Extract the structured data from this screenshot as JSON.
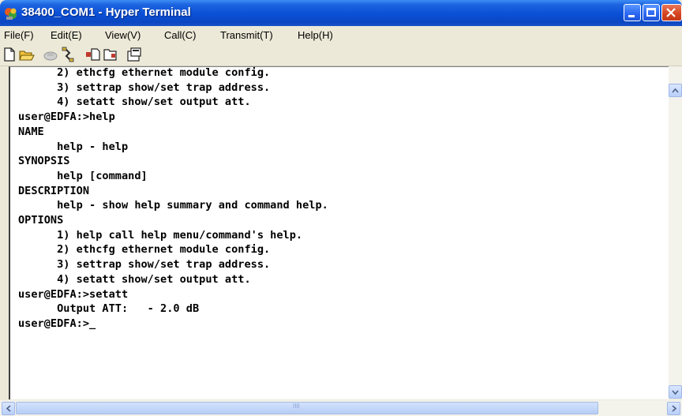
{
  "window": {
    "title": "38400_COM1 - Hyper Terminal"
  },
  "menu": [
    "File(F)",
    "Edit(E)",
    "View(V)",
    "Call(C)",
    "Transmit(T)",
    "Help(H)"
  ],
  "toolbar": {
    "icons": [
      "new-document-icon",
      "open-folder-icon",
      "call-icon",
      "disconnect-icon",
      "send-file-icon",
      "receive-file-icon",
      "properties-icon"
    ]
  },
  "terminal": {
    "lines": [
      "      2) ethcfg ethernet module config.",
      "      3) settrap show/set trap address.",
      "      4) setatt show/set output att.",
      "user@EDFA:>help",
      "NAME",
      "      help - help",
      "SYNOPSIS",
      "      help [command]",
      "DESCRIPTION",
      "      help - show help summary and command help.",
      "OPTIONS",
      "      1) help call help menu/command's help.",
      "      2) ethcfg ethernet module config.",
      "      3) settrap show/set trap address.",
      "      4) setatt show/set output att.",
      "user@EDFA:>setatt",
      "      Output ATT:   - 2.0 dB",
      "user@EDFA:>_"
    ]
  },
  "scrollbar": {
    "horizontal_grip": "IIII"
  },
  "colors": {
    "titlebar": "#0a4fd6",
    "close_button": "#d5431e",
    "chrome": "#ece9d8"
  }
}
